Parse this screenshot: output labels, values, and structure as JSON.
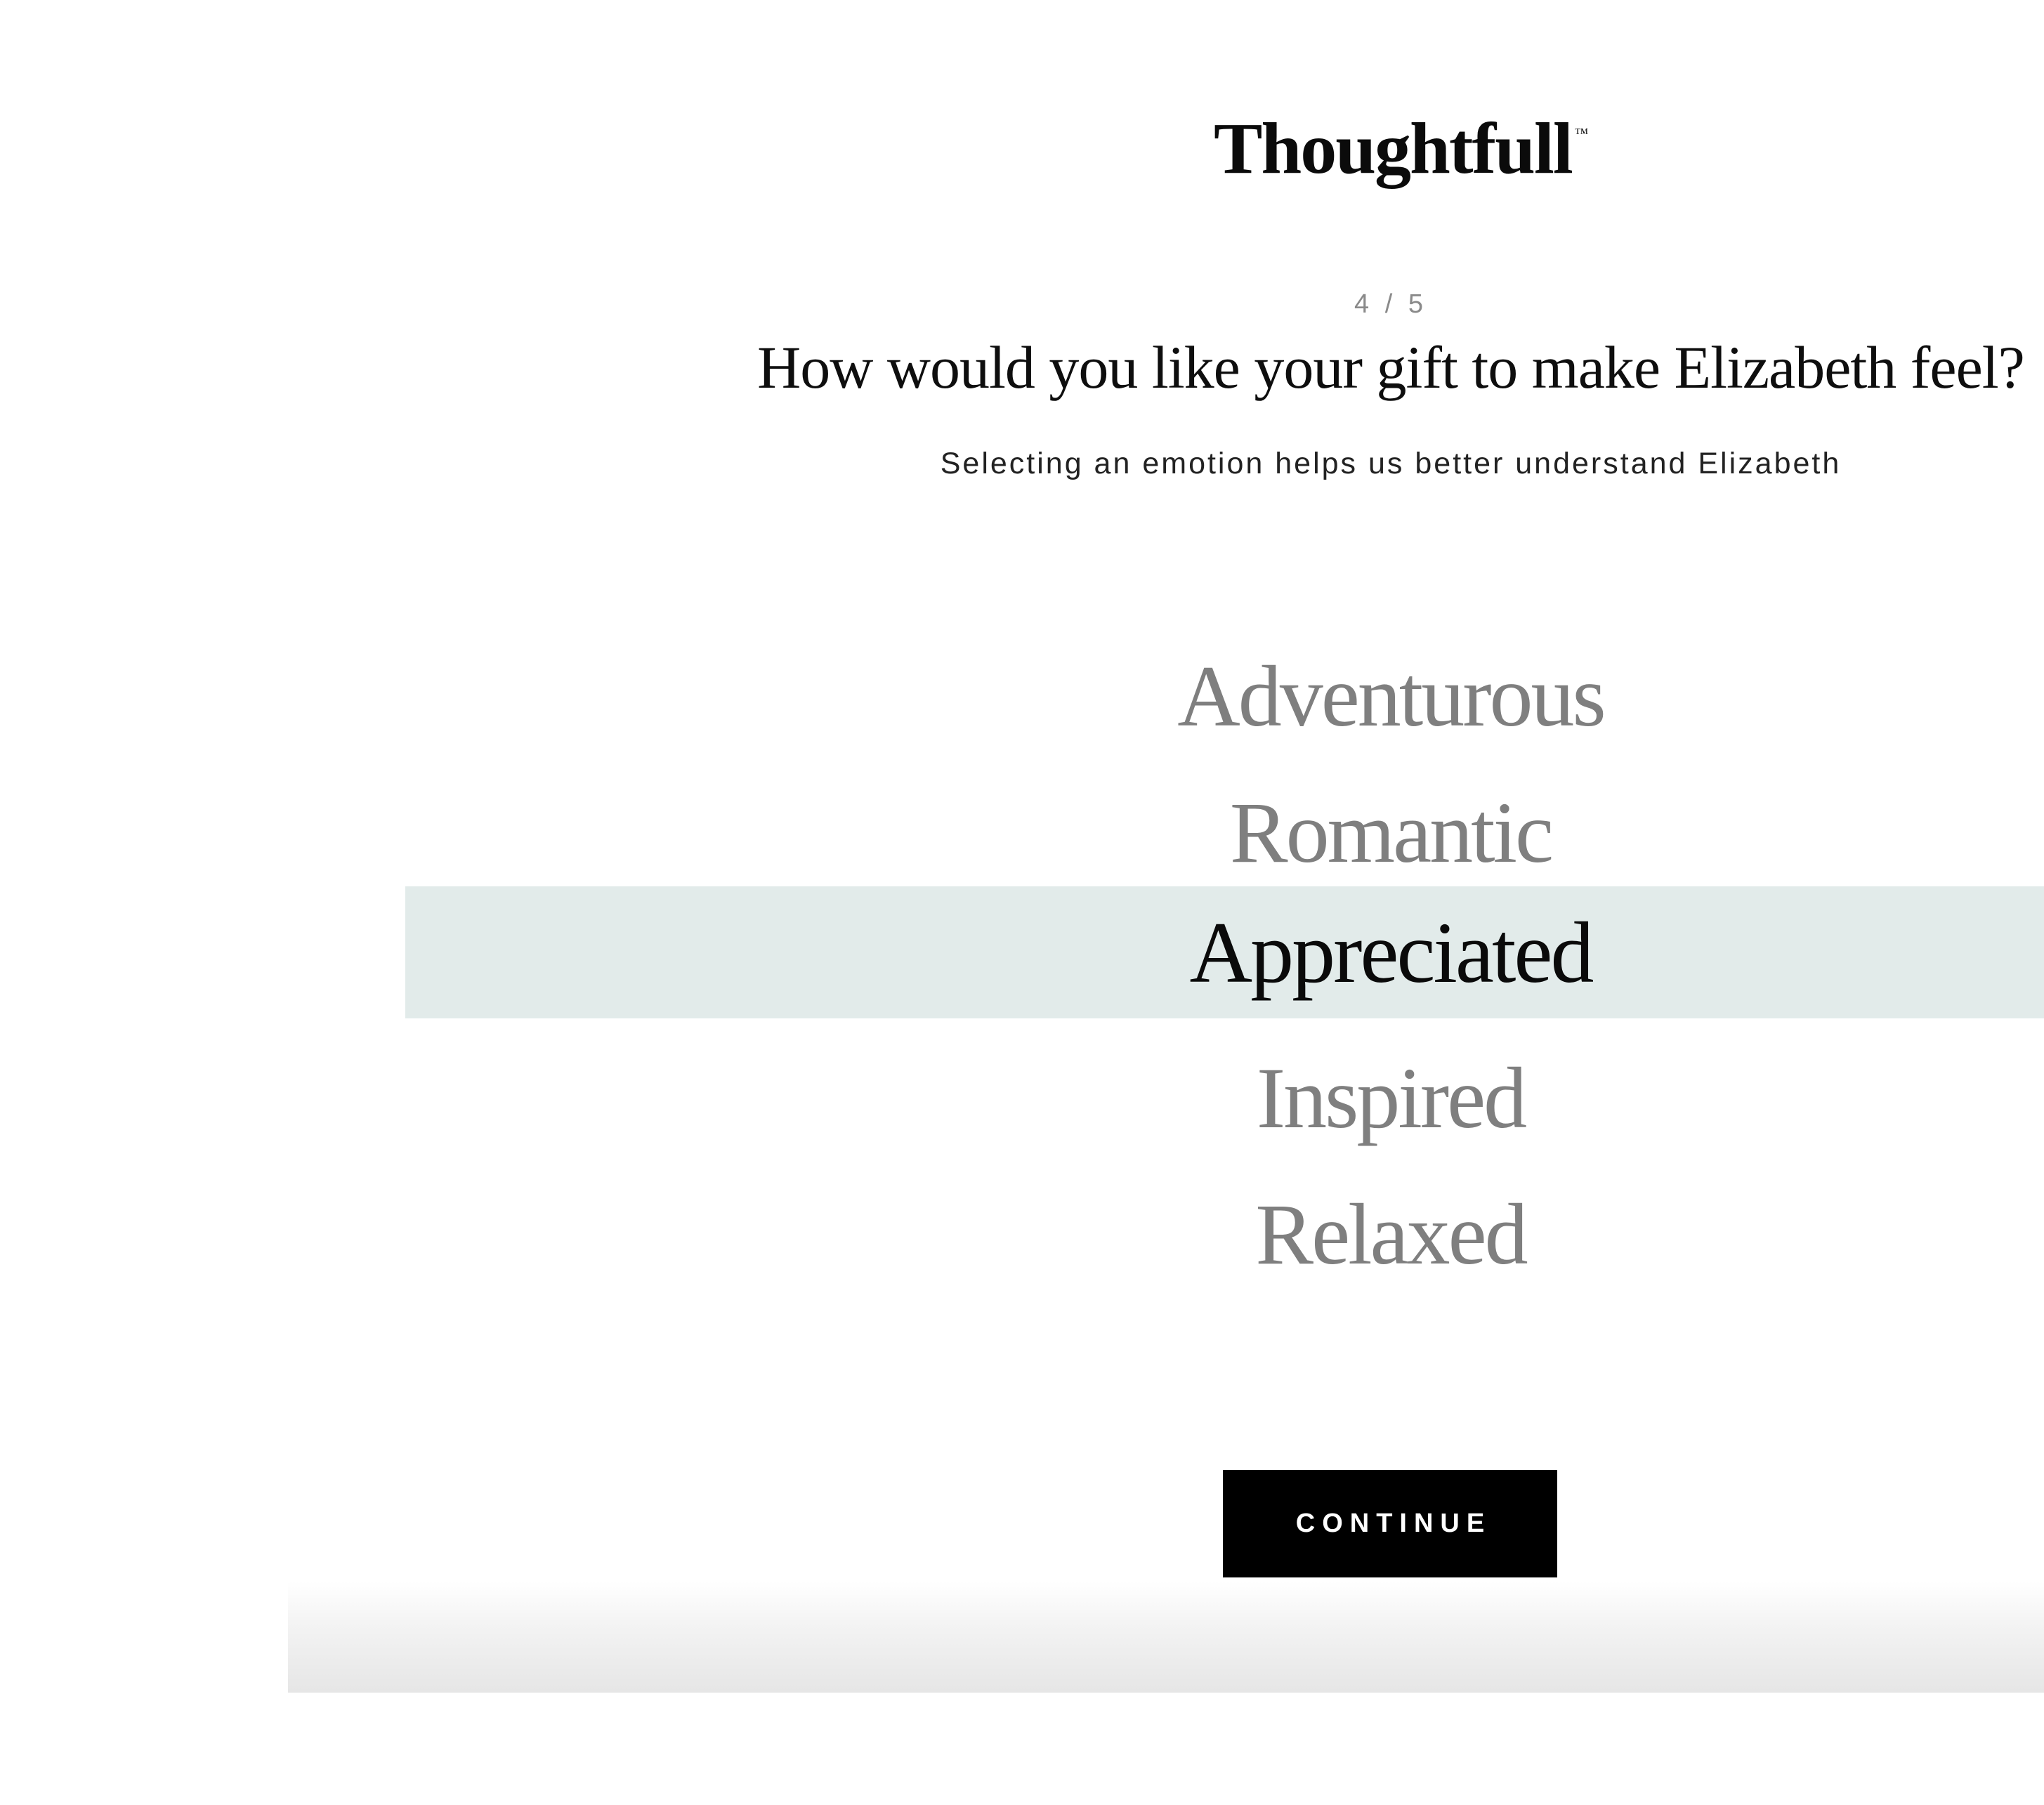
{
  "brand": {
    "logo_text": "Thoughtfull",
    "trademark": "™"
  },
  "step": {
    "current": 4,
    "total": 5,
    "label": "4 / 5"
  },
  "question": {
    "title": "How would you like your gift to make Elizabeth feel?",
    "subtitle": "Selecting an emotion helps us better understand Elizabeth"
  },
  "options": {
    "selected": "Appreciated",
    "items": [
      {
        "label": "Adventurous"
      },
      {
        "label": "Romantic"
      },
      {
        "label": "Appreciated"
      },
      {
        "label": "Inspired"
      },
      {
        "label": "Relaxed"
      }
    ]
  },
  "actions": {
    "continue_label": "CONTINUE"
  },
  "colors": {
    "selected_band": "#e2ebea",
    "option_inactive": "#7f7f7f",
    "option_active": "#0a0a0a",
    "button_bg": "#000000",
    "button_text": "#ffffff"
  }
}
